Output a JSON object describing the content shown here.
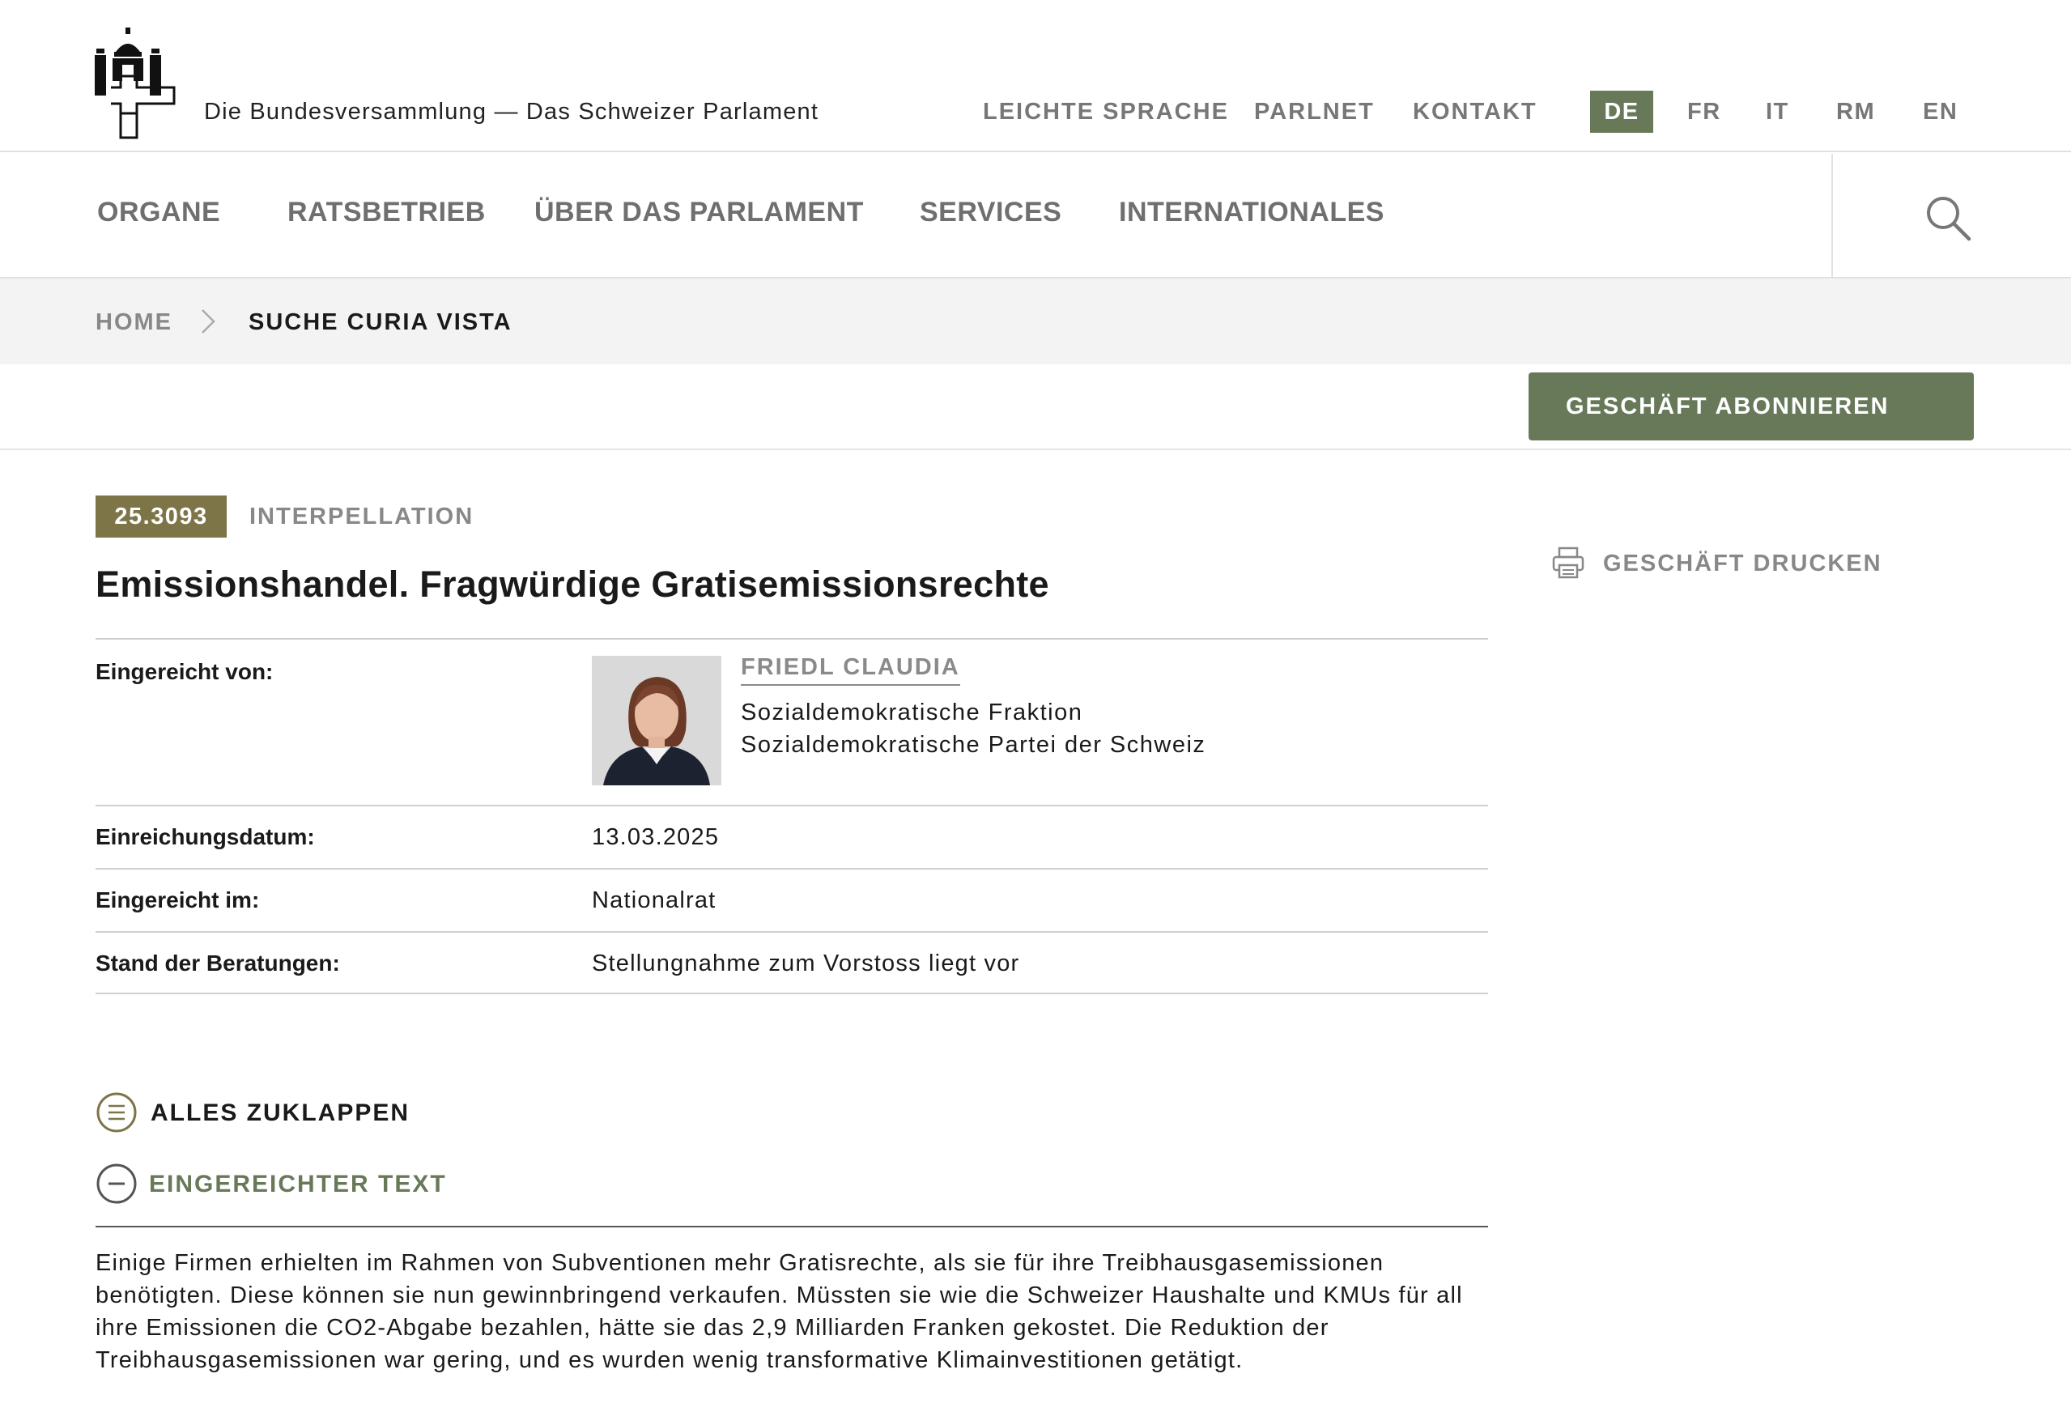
{
  "header": {
    "site_title": "Die Bundesversammlung — Das Schweizer Parlament",
    "meta_links": [
      "LEICHTE SPRACHE",
      "PARLNET",
      "KONTAKT"
    ],
    "languages": [
      "DE",
      "FR",
      "IT",
      "RM",
      "EN"
    ],
    "active_language": "DE"
  },
  "nav": {
    "items": [
      "ORGANE",
      "RATSBETRIEB",
      "ÜBER DAS PARLAMENT",
      "SERVICES",
      "INTERNATIONALES"
    ],
    "search_icon": "magnifier-icon"
  },
  "breadcrumb": {
    "home": "HOME",
    "current": "SUCHE CURIA VISTA"
  },
  "actions": {
    "subscribe": "GESCHÄFT ABONNIEREN",
    "print": "GESCHÄFT DRUCKEN"
  },
  "business": {
    "number": "25.3093",
    "type": "INTERPELLATION",
    "title": "Emissionshandel. Fragwürdige Gratisemissionsrechte"
  },
  "details": {
    "submitted_by_label": "Eingereicht von:",
    "author_name": "FRIEDL CLAUDIA",
    "author_group": "Sozialdemokratische Fraktion",
    "author_party": "Sozialdemokratische Partei der Schweiz",
    "date_label": "Einreichungsdatum:",
    "date_value": "13.03.2025",
    "council_label": "Eingereicht im:",
    "council_value": "Nationalrat",
    "status_label": "Stand der Beratungen:",
    "status_value": "Stellungnahme zum Vorstoss liegt vor"
  },
  "sections": {
    "collapse_all": "ALLES ZUKLAPPEN",
    "submitted_text_heading": "EINGEREICHTER TEXT",
    "submitted_text_lines": [
      "Einige Firmen erhielten im Rahmen von Subventionen mehr Gratisrechte, als sie für ihre Treibhausgasemissionen",
      "benötigten. Diese können sie nun gewinnbringend verkaufen. Müssten sie wie die Schweizer Haushalte und KMUs für all",
      "ihre Emissionen die CO2-Abgabe bezahlen, hätte sie das 2,9 Milliarden Franken gekostet. Die Reduktion der",
      "Treibhausgasemissionen war gering, und es wurden wenig transformative Klimainvestitionen getätigt."
    ]
  },
  "colors": {
    "accent_green": "#68795a",
    "badge_olive": "#7d7547",
    "muted_text": "#888888"
  }
}
